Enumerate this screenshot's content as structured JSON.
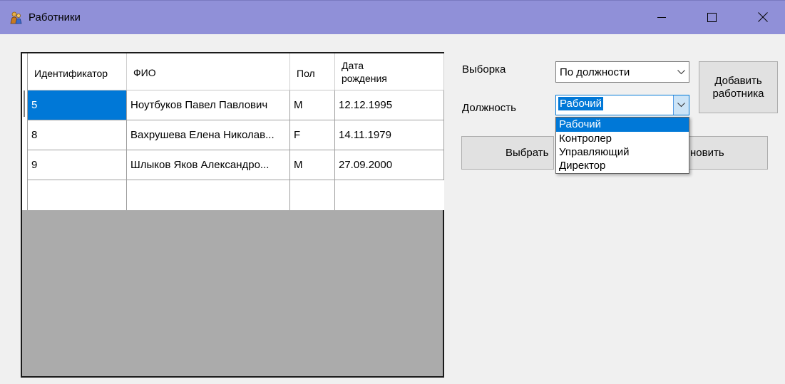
{
  "window": {
    "title": "Работники",
    "icon": "people-icon",
    "controls": [
      "minimize-icon",
      "maximize-icon",
      "close-icon"
    ]
  },
  "grid": {
    "columns": [
      "Идентификатор",
      "ФИО",
      "Пол",
      "Дата рождения"
    ],
    "date_header": [
      "Дата",
      "рождения"
    ],
    "rows": [
      {
        "id": "5",
        "name": "Ноутбуков Павел Павлович",
        "sex": "M",
        "birth": "12.12.1995"
      },
      {
        "id": "8",
        "name": "Вахрушева Елена Николав...",
        "sex": "F",
        "birth": "14.11.1979"
      },
      {
        "id": "9",
        "name": "Шлыков Яков Александро...",
        "sex": "M",
        "birth": "27.09.2000"
      }
    ]
  },
  "filter": {
    "selection_label": "Выборка",
    "selection_value": "По должности",
    "position_label": "Должность",
    "position_value": "Рабочий",
    "position_options": [
      "Рабочий",
      "Контролер",
      "Управляющий",
      "Директор"
    ]
  },
  "buttons": {
    "add_line1": "Добавить",
    "add_line2": "работника",
    "select_visible": "Выбрать",
    "refresh_visible": "новить"
  },
  "colors": {
    "titlebar": "#9090d8",
    "selection": "#0078d7",
    "grid_background": "#ababab"
  }
}
